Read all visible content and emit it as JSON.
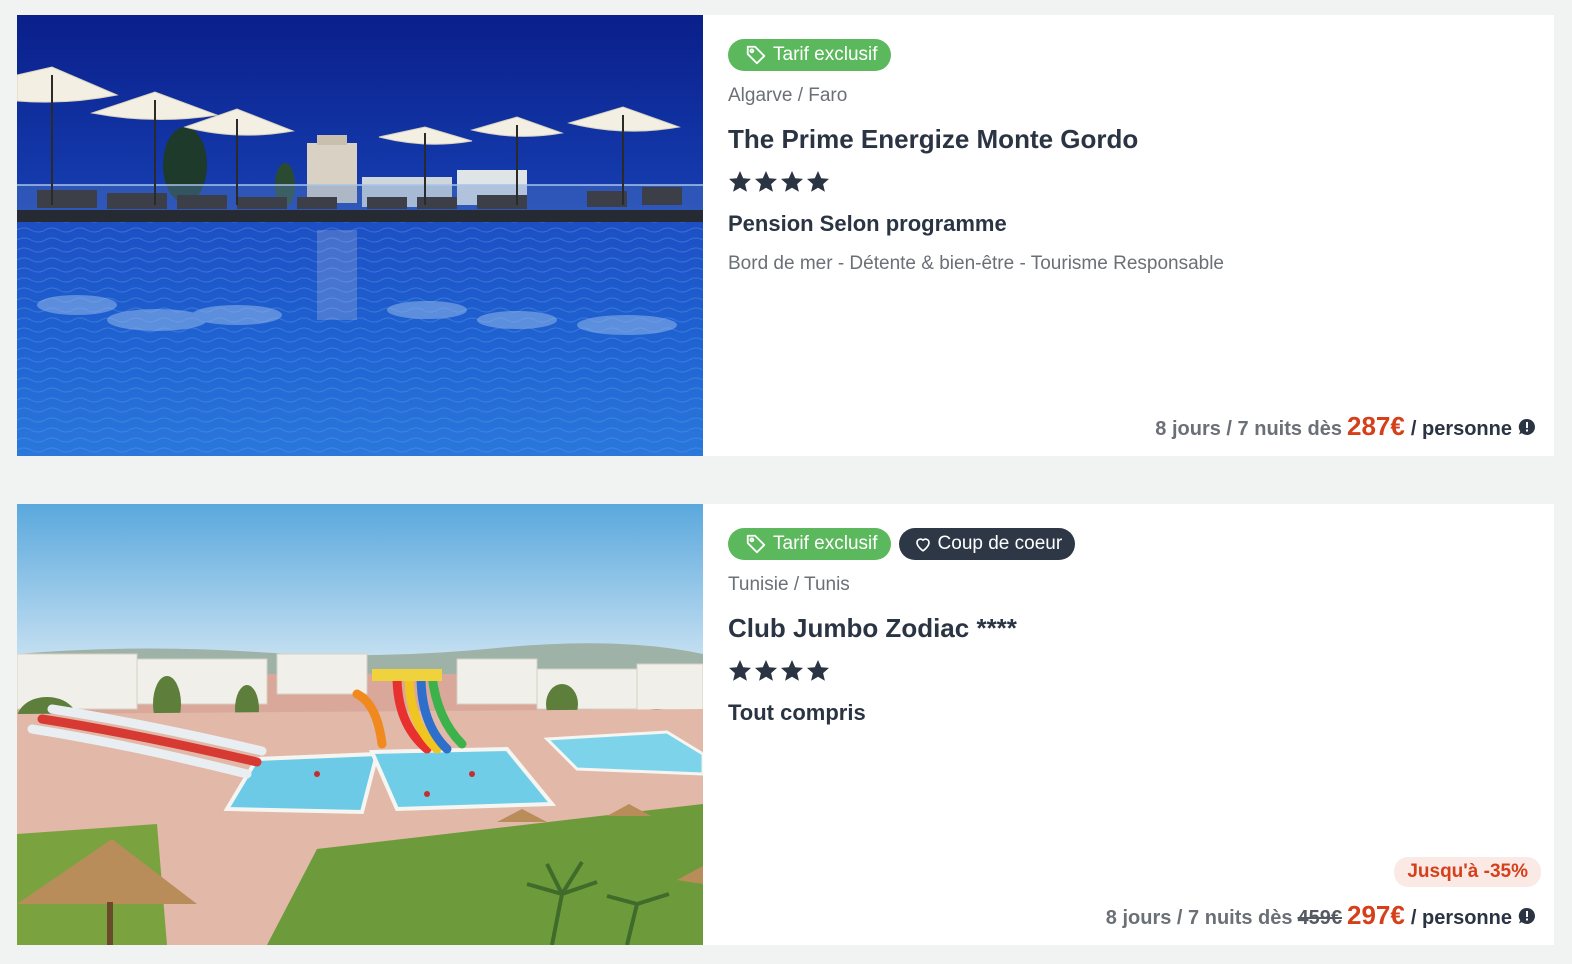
{
  "colors": {
    "page_bg": "#f1f3f2",
    "badge_green": "#5cb85c",
    "badge_dark": "#2d3746",
    "price_red": "#d5401a",
    "text_dark": "#2a3443",
    "text_muted": "#6b6f76"
  },
  "results": [
    {
      "image_alt": "rooftop pool with parasols",
      "badges": [
        {
          "icon": "tag-icon",
          "label": "Tarif exclusif",
          "style": "green"
        }
      ],
      "location": "Algarve / Faro",
      "name": "The Prime Energize Monte Gordo",
      "stars": 4,
      "board": "Pension Selon programme",
      "tags": "Bord de mer - Détente & bien-être - Tourisme Responsable",
      "price": {
        "duration": "8 jours / 7 nuits dès",
        "old_price": "",
        "price": "287€",
        "per": "/ personne"
      },
      "discount": ""
    },
    {
      "image_alt": "resort pool with water slides",
      "badges": [
        {
          "icon": "tag-icon",
          "label": "Tarif exclusif",
          "style": "green"
        },
        {
          "icon": "heart-icon",
          "label": "Coup de coeur",
          "style": "dark"
        }
      ],
      "location": "Tunisie / Tunis",
      "name": "Club Jumbo Zodiac ****",
      "stars": 4,
      "board": "Tout compris",
      "tags": "",
      "price": {
        "duration": "8 jours / 7 nuits dès",
        "old_price": "459€",
        "price": "297€",
        "per": "/ personne"
      },
      "discount": "Jusqu'à -35%"
    }
  ]
}
